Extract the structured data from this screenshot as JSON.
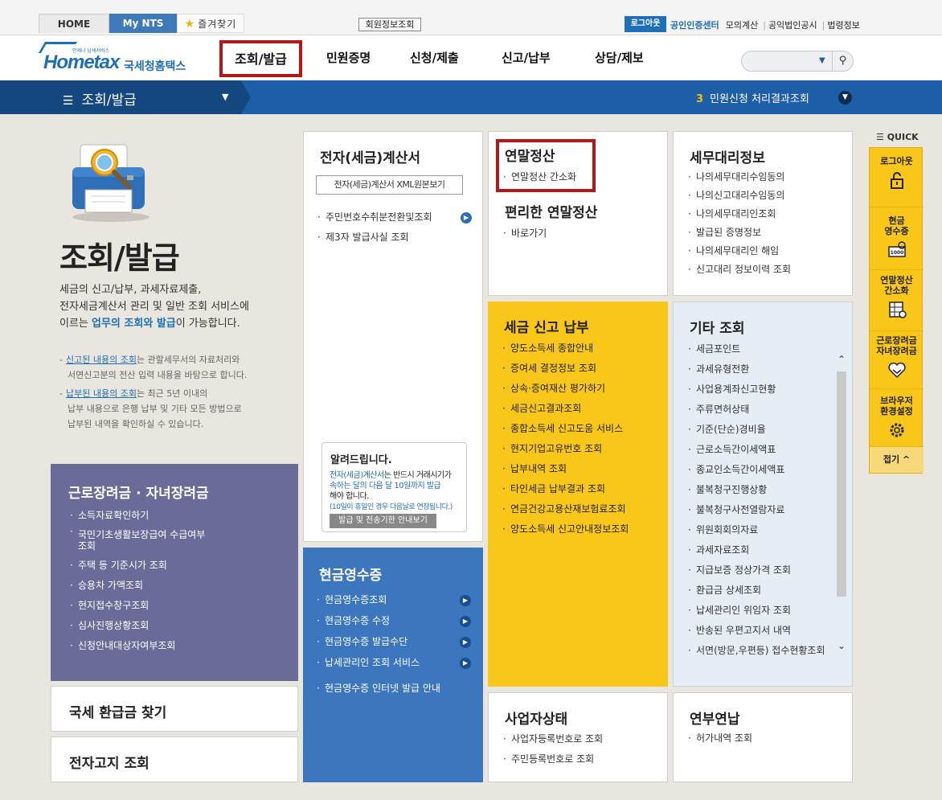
{
  "topbar": {
    "tabs": [
      "HOME",
      "My NTS",
      "즐겨찾기"
    ],
    "member_btn": "회원정보조회",
    "logout": "로그아웃",
    "links": [
      "공인인증센터",
      "모의계산",
      "공익법인공시",
      "법령정보"
    ]
  },
  "header": {
    "logo_small": "언제나 납세서비스",
    "logo_main": "Hometax",
    "logo_kr": "국세청홈택스",
    "menu": [
      "조회/발급",
      "민원증명",
      "신청/제출",
      "신고/납부",
      "상담/제보"
    ]
  },
  "subnav": {
    "current": "조회/발급",
    "notice_num": "3",
    "notice_text": "민원신청 처리결과조회"
  },
  "hero": {
    "title": "조회/발급",
    "desc_1": "세금의 신고/납부, 과세자료제출,",
    "desc_2": "전자세금계산서 관리 및 일반 조회 서비스에",
    "desc_3a": "이르는 ",
    "desc_3b": "업무의 조회와 발급",
    "desc_3c": "이 가능합니다.",
    "note1_hl": "신고된 내용의 조회",
    "note1_a": "는 관할세무서의 자료처리와",
    "note1_b": "서면신고분의 전산 입력 내용을 바탕으로 합니다.",
    "note2_hl": "납부된 내용의 조회",
    "note2_a": "는 최근 5년 이내의",
    "note2_b": "납부 내용으로 은행 납부 및 기타 모든 방법으로",
    "note2_c": "납부된 내역을 확인하실 수 있습니다."
  },
  "cards": {
    "purple": {
      "title": "근로장려금 · 자녀장려금",
      "items": [
        "소득자료확인하기",
        "국민기초생활보장급여 수급여부",
        "조회",
        "주택 등 기준시가 조회",
        "승용차 가액조회",
        "현지접수창구조회",
        "심사진행상황조회",
        "신청안내대상자여부조회"
      ]
    },
    "refund": {
      "title": "국세 환급금 찾기"
    },
    "notice": {
      "title": "전자고지 조회"
    },
    "einvoice": {
      "title": "전자(세금)계산서",
      "xml_btn": "전자(세금)계산서 XML원본보기",
      "items": [
        "주민번호수취분전환및조회",
        "제3자 발급사실 조회"
      ],
      "alert_title": "알려드립니다.",
      "alert_hl": "전자(세금)계산서",
      "alert_1": "는 반드시 거래시기가",
      "alert_2": "속하는 달의 다음 달 10일까지 발급",
      "alert_3": "해야 합니다.",
      "alert_small": "(10일이 휴일인 경우 다음날로 연장됩니다.)",
      "alert_btn": "발급 및 전송기한 안내보기"
    },
    "cash": {
      "title": "현금영수증",
      "items": [
        "현금영수증조회",
        "현금영수증 수정",
        "현금영수증 발급수단",
        "납세관리인 조회 서비스"
      ],
      "extra": "현금영수증 인터넷 발급 안내"
    },
    "yearend": {
      "title_a": "연말정산",
      "items_a": [
        "연말정산 간소화"
      ],
      "title_b": "편리한 연말정산",
      "items_b": [
        "바로가기"
      ]
    },
    "tax": {
      "title": "세금 신고 납부",
      "items": [
        "양도소득세 종합안내",
        "증여세 결정정보 조회",
        "상속·증여재산 평가하기",
        "세금신고결과조회",
        "종합소득세 신고도움 서비스",
        "현지기업고유번호 조회",
        "납부내역 조회",
        "타인세금 납부결과 조회",
        "연금건강고용산재보험료조회",
        "양도소득세 신고안내정보조회"
      ]
    },
    "biz": {
      "title": "사업자상태",
      "items": [
        "사업자등록번호로 조회",
        "주민등록번호로 조회"
      ]
    },
    "agent": {
      "title": "세무대리정보",
      "items": [
        "나의세무대리수임동의",
        "나의신고대리수임동의",
        "나의세무대리인조회",
        "발급된 증명정보",
        "나의세무대리인 해임",
        "신고대리 정보이력 조회"
      ]
    },
    "etc": {
      "title": "기타 조회",
      "items": [
        "세금포인트",
        "과세유형전환",
        "사업용계좌신고현황",
        "주류면허상태",
        "기준(단순)경비율",
        "근로소득간이세액표",
        "종교인소득간이세액표",
        "불복청구진행상황",
        "불복청구사전열람자료",
        "위원회회의자료",
        "과세자료조회",
        "지급보증 정상가격 조회",
        "환급금 상세조회",
        "납세관리인 위임자 조회",
        "반송된 우편고지서 내역",
        "서면(방문,우편등) 접수현황조회"
      ]
    },
    "pension": {
      "title": "연부연납",
      "items": [
        "허가내역 조회"
      ]
    }
  },
  "quick": {
    "head": "QUICK",
    "items": [
      "로그아웃",
      "현금\n영수증",
      "연말정산\n간소화",
      "근로장려금\n자녀장려금",
      "브라우저\n환경설정"
    ],
    "fold": "접기"
  }
}
